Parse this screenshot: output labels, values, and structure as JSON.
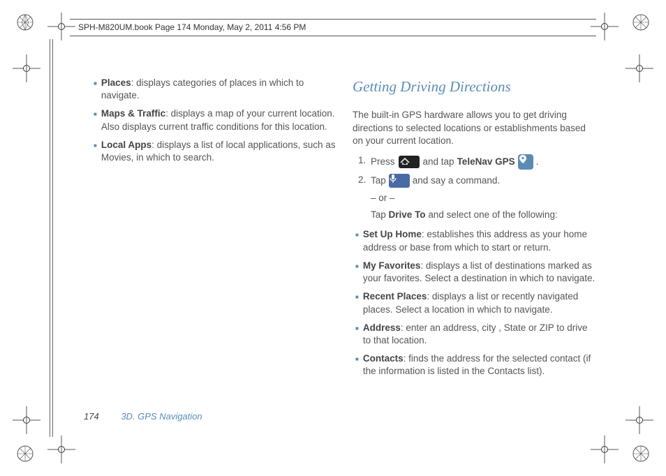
{
  "header": "SPH-M820UM.book  Page 174  Monday, May 2, 2011  4:56 PM",
  "leftColumn": {
    "bullets": [
      {
        "label": "Places",
        "text": ": displays categories of places in which to navigate."
      },
      {
        "label": "Maps & Traffic",
        "text": ": displays a map of your current location. Also displays current traffic conditions for this location."
      },
      {
        "label": "Local Apps",
        "text": ": displays a list of local applications, such as Movies, in which to search."
      }
    ]
  },
  "rightColumn": {
    "title": "Getting Driving Directions",
    "intro": "The built-in GPS hardware allows you to get driving directions to selected locations or establishments based on your current location.",
    "step1_a": "Press",
    "step1_b": "and tap",
    "step1_label": "TeleNav GPS",
    "step1_end": ".",
    "step2_a": "Tap",
    "step2_b": "and say a command.",
    "or": "– or –",
    "tap_a": "Tap",
    "tap_label": "Drive To",
    "tap_b": "and select one of the following:",
    "bullets": [
      {
        "label": "Set Up Home",
        "text": ": establishes this address as your home address or base from which to start or return."
      },
      {
        "label": "My Favorites",
        "text": ": displays a list of destinations marked as your favorites. Select a destination in which to navigate."
      },
      {
        "label": "Recent Places",
        "text": ": displays a list or recently navigated places. Select a location in which to navigate."
      },
      {
        "label": "Address",
        "text": ": enter an address, city , State or ZIP to drive to that location."
      },
      {
        "label": "Contacts",
        "text": ": finds the address for the selected contact (if the information is listed in the Contacts list)."
      }
    ]
  },
  "footer": {
    "page": "174",
    "section": "3D. GPS Navigation"
  }
}
